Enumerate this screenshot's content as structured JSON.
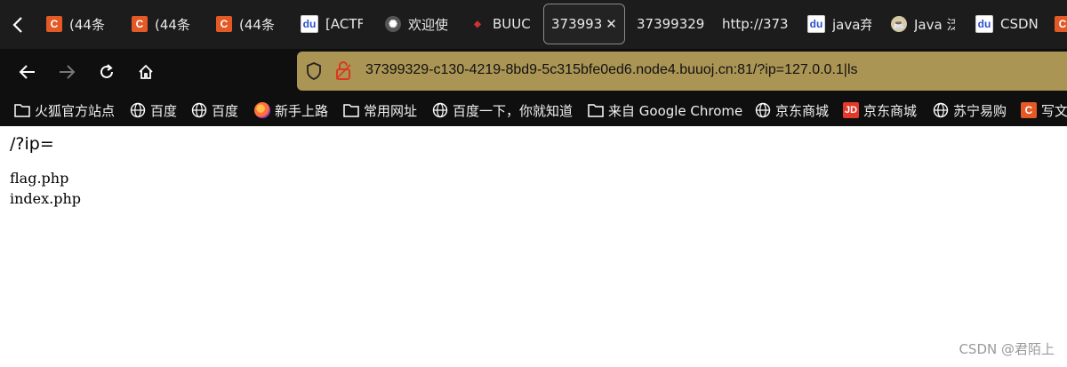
{
  "tabs": [
    {
      "title": "(44条",
      "favicon": "csdn-icon",
      "active": false
    },
    {
      "title": "(44条",
      "favicon": "csdn-icon",
      "active": false
    },
    {
      "title": "(44条",
      "favicon": "csdn-icon",
      "active": false
    },
    {
      "title": "[ACTF",
      "favicon": "baidu-icon",
      "active": false
    },
    {
      "title": "欢迎使",
      "favicon": "gear-icon",
      "active": false
    },
    {
      "title": "BUUC",
      "favicon": "buuctf-icon",
      "active": false
    },
    {
      "title": "373993",
      "favicon": "",
      "active": true,
      "close": "✕"
    },
    {
      "title": "37399329",
      "favicon": "",
      "active": false
    },
    {
      "title": "http://373",
      "favicon": "",
      "active": false
    },
    {
      "title": "java弃",
      "favicon": "baidu-icon",
      "active": false
    },
    {
      "title": "Java 泛",
      "favicon": "java-icon",
      "active": false
    },
    {
      "title": "CSDN",
      "favicon": "baidu-icon",
      "active": false
    }
  ],
  "navbar": {
    "url": "37399329-c130-4219-8bd9-5c315bfe0ed6.node4.buuoj.cn:81/?ip=127.0.0.1|ls"
  },
  "bookmarks": [
    {
      "label": "火狐官方站点",
      "icon": "folder-icon"
    },
    {
      "label": "百度",
      "icon": "globe-icon"
    },
    {
      "label": "百度",
      "icon": "globe-icon"
    },
    {
      "label": "新手上路",
      "icon": "firefox-icon"
    },
    {
      "label": "常用网址",
      "icon": "folder-icon"
    },
    {
      "label": "百度一下，你就知道",
      "icon": "globe-icon"
    },
    {
      "label": "来自 Google Chrome",
      "icon": "folder-icon"
    },
    {
      "label": "京东商城",
      "icon": "globe-icon"
    },
    {
      "label": "京东商城",
      "icon": "jd-icon",
      "icon_text": "JD"
    },
    {
      "label": "苏宁易购",
      "icon": "globe-icon"
    },
    {
      "label": "写文",
      "icon": "csdn-icon",
      "icon_text": "C"
    }
  ],
  "page": {
    "route": "/?ip=",
    "output_lines": [
      "flag.php",
      "index.php"
    ]
  },
  "watermark": "CSDN @君陌上",
  "colors": {
    "urlbar": "#ab9554",
    "csdn_orange": "#e35a27",
    "chrome_bg": "#0f0f0f"
  }
}
